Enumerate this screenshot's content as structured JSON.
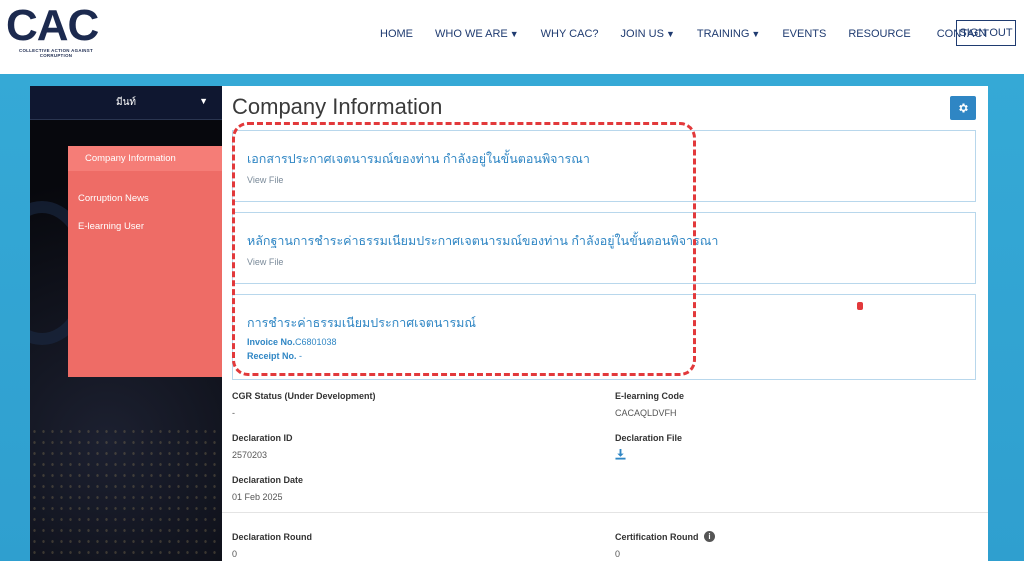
{
  "brand": {
    "logo_text": "CAC",
    "logo_subtitle": "COLLECTIVE ACTION AGAINST CORRUPTION"
  },
  "nav": {
    "items": [
      {
        "label": "HOME",
        "dropdown": false
      },
      {
        "label": "WHO WE ARE",
        "dropdown": true
      },
      {
        "label": "WHY CAC?",
        "dropdown": false
      },
      {
        "label": "JOIN US",
        "dropdown": true
      },
      {
        "label": "TRAINING",
        "dropdown": true
      },
      {
        "label": "EVENTS",
        "dropdown": false
      },
      {
        "label": "RESOURCE",
        "dropdown": false
      },
      {
        "label": "CONTACT",
        "dropdown": false
      }
    ],
    "caret": "▼",
    "signout_label": "SIGN OUT"
  },
  "sidebar": {
    "user_name": "มีนท์",
    "caret": "▼",
    "items": [
      {
        "label": "Company Information",
        "active": true
      },
      {
        "label": "Corruption News",
        "active": false
      },
      {
        "label": "E-learning User",
        "active": false
      }
    ]
  },
  "content": {
    "title": "Company Information",
    "cards": [
      {
        "title": "เอกสารประกาศเจตนารมณ์ของท่าน กำลังอยู่ในขั้นตอนพิจารณา",
        "link": "View File"
      },
      {
        "title": "หลักฐานการชำระค่าธรรมเนียมประกาศเจตนารมณ์ของท่าน กำลังอยู่ในขั้นตอนพิจารณา",
        "link": "View File"
      },
      {
        "title": "การชำระค่าธรรมเนียมประกาศเจตนารมณ์",
        "invoice_label": "Invoice No.",
        "invoice_value": "C6801038",
        "receipt_label": "Receipt No.",
        "receipt_value": "-"
      }
    ],
    "info": {
      "cgr_status_label": "CGR Status (Under Development)",
      "cgr_status_value": "-",
      "elearning_code_label": "E-learning Code",
      "elearning_code_value": "CACAQLDVFH",
      "declaration_id_label": "Declaration ID",
      "declaration_id_value": "2570203",
      "declaration_file_label": "Declaration File",
      "declaration_date_label": "Declaration Date",
      "declaration_date_value": "01 Feb 2025",
      "declaration_round_label": "Declaration Round",
      "declaration_round_value": "0",
      "certification_round_label": "Certification Round",
      "certification_round_value": "0"
    }
  },
  "colors": {
    "brand_navy": "#1c2a4f",
    "nav_text": "#1f3b70",
    "background_blue": "#35a9d6",
    "sidebar_menu": "#ee6c66",
    "link_blue": "#2f86c4",
    "annotation_red": "#e2393b"
  },
  "icons": {
    "settings": "gear-icon",
    "download": "download-icon",
    "info": "info-icon"
  }
}
